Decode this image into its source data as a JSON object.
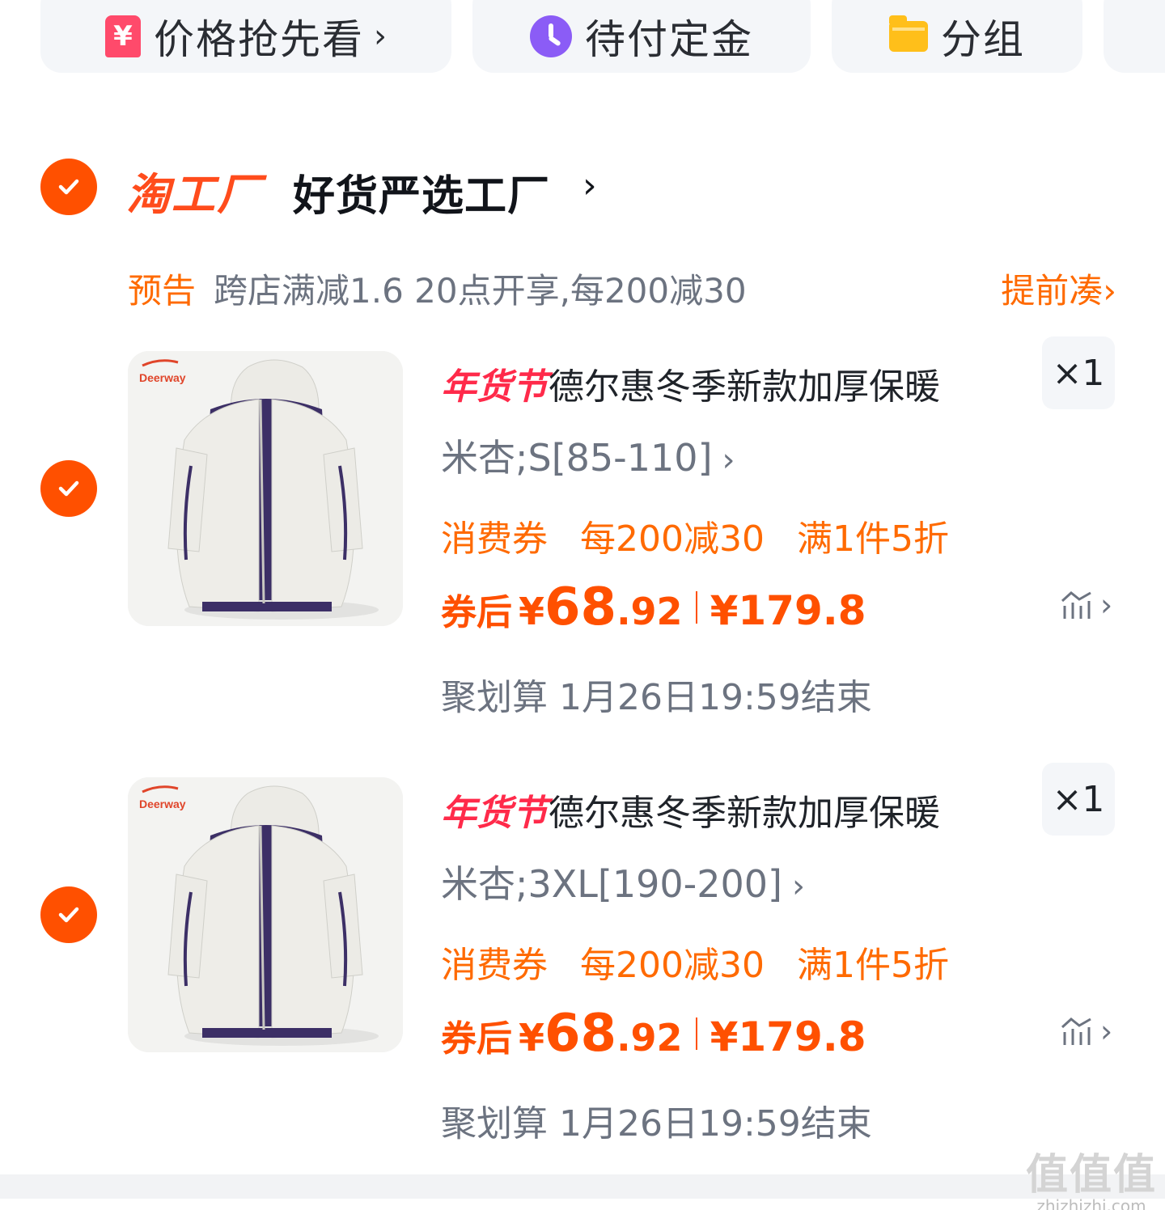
{
  "filters": [
    {
      "label": "价格抢先看",
      "icon": "price-tag-icon",
      "icon_glyph": "¥",
      "has_chevron": true,
      "color": "#ff4a6b"
    },
    {
      "label": "待付定金",
      "icon": "clock-icon",
      "has_chevron": false,
      "color": "#8b5cf6"
    },
    {
      "label": "分组",
      "icon": "folder-icon",
      "has_chevron": false,
      "color": "#ffbf1a"
    }
  ],
  "store": {
    "brand": "淘工厂",
    "name": "好货严选工厂",
    "selected": true
  },
  "promo": {
    "tag": "预告",
    "text": "跨店满减1.6 20点开享,每200减30",
    "action": "提前凑"
  },
  "items": [
    {
      "selected": true,
      "thumb_brand": "Deerway",
      "title_tag": "年货节",
      "title": "德尔惠冬季新款加厚保暖",
      "qty": "×1",
      "sku": "米杏;S[85-110]",
      "coupons": [
        "消费券",
        "每200减30",
        "满1件5折"
      ],
      "price_label": "券后",
      "currency": "¥",
      "price_int": "68",
      "price_dec": ".92",
      "orig_price": "¥179.8",
      "deadline": "聚划算 1月26日19:59结束"
    },
    {
      "selected": true,
      "thumb_brand": "Deerway",
      "title_tag": "年货节",
      "title": "德尔惠冬季新款加厚保暖",
      "qty": "×1",
      "sku": "米杏;3XL[190-200]",
      "coupons": [
        "消费券",
        "每200减30",
        "满1件5折"
      ],
      "price_label": "券后",
      "currency": "¥",
      "price_int": "68",
      "price_dec": ".92",
      "orig_price": "¥179.8",
      "deadline": "聚划算 1月26日19:59结束"
    }
  ],
  "watermark": {
    "glyphs": "值值值",
    "url": "zhizhizhi.com"
  },
  "colors": {
    "accent": "#ff5000",
    "promo": "#ff6a00",
    "tag_red": "#ff2a4a",
    "muted": "#6c7380"
  }
}
